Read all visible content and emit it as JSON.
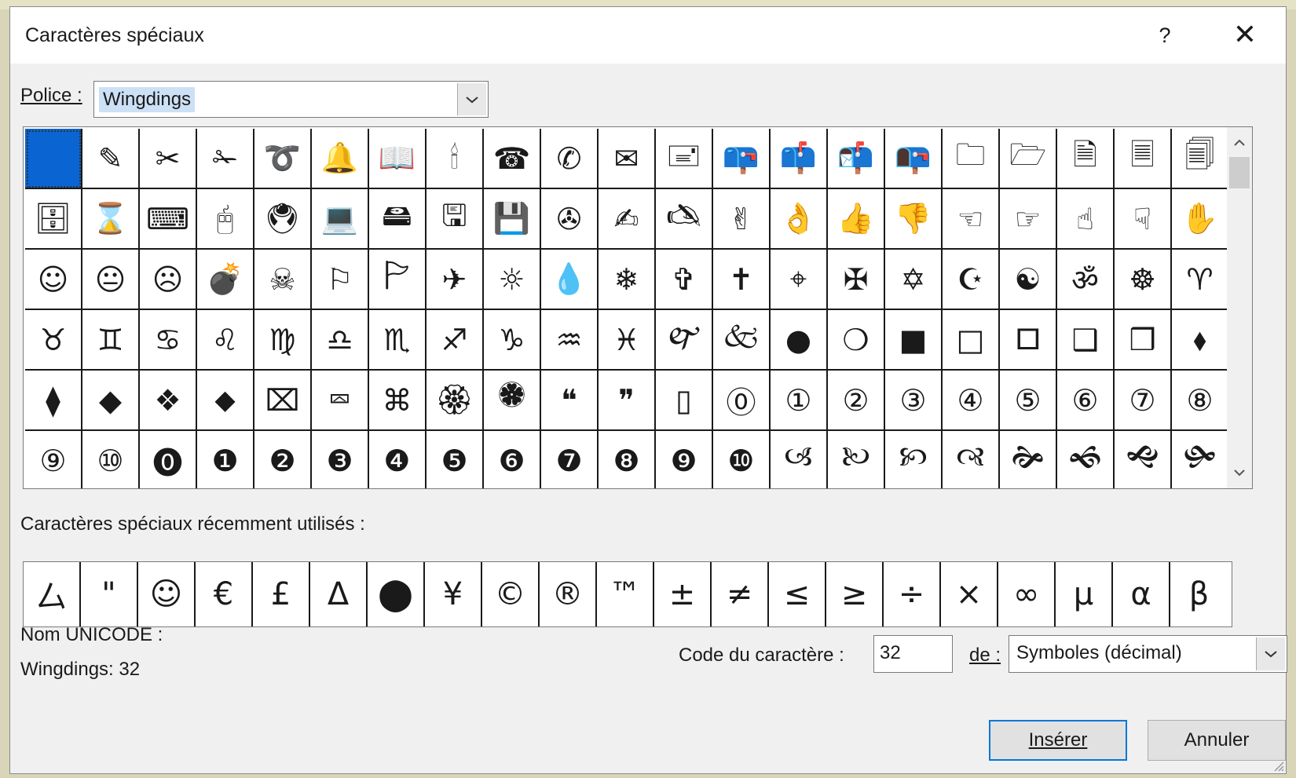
{
  "dialog": {
    "title": "Caractères spéciaux",
    "help_label": "?",
    "close_label": "✕"
  },
  "font": {
    "label": "Police :",
    "value": "Wingdings"
  },
  "glyph_grid": {
    "rows": [
      [
        " ",
        "✎",
        "✂",
        "✁",
        "➰",
        "🔔",
        "📖",
        "🕯",
        "☎",
        "✆",
        "✉",
        "🖃",
        "📪",
        "📫",
        "📬",
        "📭",
        "🗀",
        "🗁",
        "🗎",
        "🗏",
        "🗐"
      ],
      [
        "🗄",
        "⌛",
        "⌨",
        "🖰",
        "🖲",
        "💻",
        "🖴",
        "🖫",
        "💾",
        "✇",
        "✍",
        "🖎",
        "✌",
        "👌",
        "👍",
        "👎",
        "☜",
        "☞",
        "☝",
        "☟",
        "✋"
      ],
      [
        "☺",
        "😐",
        "☹",
        "💣",
        "☠",
        "⚐",
        "🏱",
        "✈",
        "☼",
        "💧",
        "❄",
        "✞",
        "✝",
        "⌖",
        "✠",
        "✡",
        "☪",
        "☯",
        "ॐ",
        "☸",
        "♈"
      ],
      [
        "♉",
        "♊",
        "♋",
        "♌",
        "♍",
        "♎",
        "♏",
        "♐",
        "♑",
        "♒",
        "♓",
        "🙰",
        "🙵",
        "●",
        "❍",
        "■",
        "□",
        "🞐",
        "❑",
        "❒",
        "⬧"
      ],
      [
        "⧫",
        "◆",
        "❖",
        "⬥",
        "⌧",
        "⮹",
        "⌘",
        "🏵",
        "🏶",
        "❝",
        "❞",
        "▯",
        "⓪",
        "①",
        "②",
        "③",
        "④",
        "⑤",
        "⑥",
        "⑦",
        "⑧"
      ],
      [
        "⑨",
        "⑩",
        "⓿",
        "❶",
        "❷",
        "❸",
        "❹",
        "❺",
        "❻",
        "❼",
        "❽",
        "❾",
        "❿",
        "🙢",
        "🙠",
        "🙡",
        "🙣",
        "🙞",
        "🙜",
        "🙝",
        "🙟"
      ]
    ]
  },
  "recent": {
    "label": "Caractères spéciaux récemment utilisés :",
    "symbols": [
      "⼛",
      "\"",
      "☺",
      "€",
      "£",
      "Δ",
      "⬤",
      "¥",
      "©",
      "®",
      "™",
      "±",
      "≠",
      "≤",
      "≥",
      "÷",
      "×",
      "∞",
      "μ",
      "α",
      "β"
    ]
  },
  "unicode": {
    "name_label": "Nom UNICODE :",
    "name_value": "Wingdings: 32"
  },
  "char_code": {
    "label": "Code du caractère :",
    "value": "32",
    "from_label": "de :",
    "from_value": "Symboles (décimal)"
  },
  "buttons": {
    "insert": "Insérer",
    "cancel": "Annuler"
  },
  "colors": {
    "selection": "#0a64d2",
    "default_button_border": "#0078d7"
  }
}
